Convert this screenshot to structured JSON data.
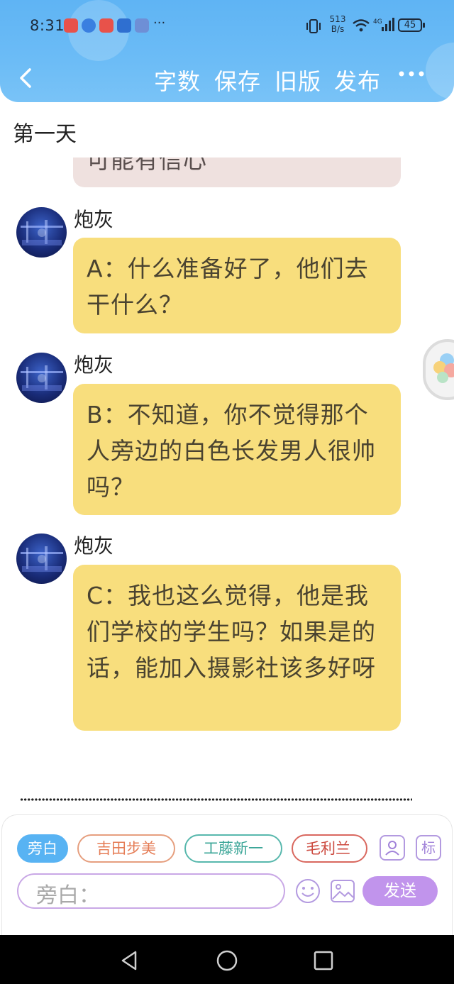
{
  "status_bar": {
    "time": "8:31",
    "net_speed_value": "513",
    "net_speed_unit": "B/s",
    "battery": "45",
    "more": "···"
  },
  "header": {
    "nav_items": [
      "字数",
      "保存",
      "旧版",
      "发布"
    ],
    "accent_color": "#6cbcf6"
  },
  "chapter_title": "第一天",
  "messages": [
    {
      "speaker": "",
      "text": "可能有信心",
      "style": "pink",
      "partial": true
    },
    {
      "speaker": "炮灰",
      "text": "A：什么准备好了，他们去干什么？",
      "style": "yellow"
    },
    {
      "speaker": "炮灰",
      "text": "B：不知道，你不觉得那个人旁边的白色长发男人很帅吗？",
      "style": "yellow"
    },
    {
      "speaker": "炮灰",
      "text": "C：我也这么觉得，他是我们学校的学生吗？如果是的话，能加入摄影社该多好呀",
      "style": "yellow"
    }
  ],
  "composer": {
    "role_chips": [
      {
        "label": "旁白",
        "active": true
      },
      {
        "label": "吉田步美",
        "active": false
      },
      {
        "label": "工藤新一",
        "active": false
      },
      {
        "label": "毛利兰",
        "active": false
      }
    ],
    "tag_icon_label": "标",
    "input_placeholder": "旁白：",
    "send_label": "发送",
    "send_color": "#c194ec"
  },
  "icons": {
    "back": "chevron-left-icon",
    "more": "more-dots-icon",
    "person": "person-icon",
    "tag": "tag-icon",
    "emoji": "emoji-icon",
    "image": "image-icon",
    "float": "bubbles-icon"
  }
}
